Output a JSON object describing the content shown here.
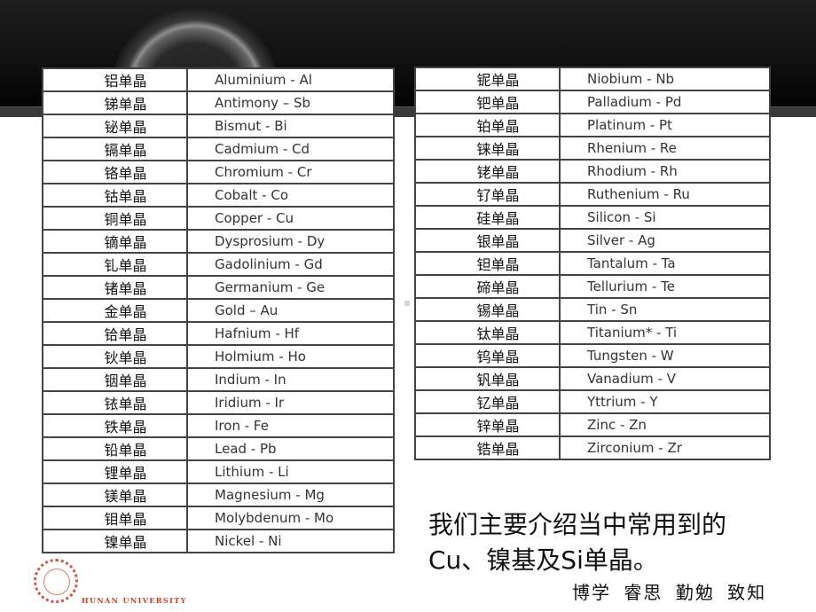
{
  "colors": {
    "header_bg": "#111111",
    "band": "#3a3a3a",
    "table_border": "#444444",
    "logo_red": "#c8402c"
  },
  "left_table": [
    {
      "cn": "铝单晶",
      "en": "Aluminium - Al"
    },
    {
      "cn": "锑单晶",
      "en": "Antimony – Sb"
    },
    {
      "cn": "铋单晶",
      "en": "Bismut - Bi"
    },
    {
      "cn": "镉单晶",
      "en": "Cadmium - Cd"
    },
    {
      "cn": "铬单晶",
      "en": "Chromium - Cr"
    },
    {
      "cn": "钴单晶",
      "en": "Cobalt - Co"
    },
    {
      "cn": "铜单晶",
      "en": "Copper - Cu"
    },
    {
      "cn": "镝单晶",
      "en": "Dysprosium - Dy"
    },
    {
      "cn": "钆单晶",
      "en": "Gadolinium - Gd"
    },
    {
      "cn": "锗单晶",
      "en": "Germanium - Ge"
    },
    {
      "cn": "金单晶",
      "en": "Gold – Au"
    },
    {
      "cn": "铪单晶",
      "en": "Hafnium - Hf"
    },
    {
      "cn": "钬单晶",
      "en": "Holmium - Ho"
    },
    {
      "cn": "铟单晶",
      "en": "Indium - In"
    },
    {
      "cn": "铱单晶",
      "en": "Iridium - Ir"
    },
    {
      "cn": "铁单晶",
      "en": "Iron - Fe"
    },
    {
      "cn": "铅单晶",
      "en": "Lead - Pb"
    },
    {
      "cn": "锂单晶",
      "en": "Lithium - Li"
    },
    {
      "cn": "镁单晶",
      "en": "Magnesium - Mg"
    },
    {
      "cn": "钼单晶",
      "en": "Molybdenum - Mo"
    },
    {
      "cn": "镍单晶",
      "en": "Nickel - Ni"
    }
  ],
  "right_table": [
    {
      "cn": "铌单晶",
      "en": "Niobium - Nb"
    },
    {
      "cn": "钯单晶",
      "en": "Palladium - Pd"
    },
    {
      "cn": "铂单晶",
      "en": "Platinum - Pt"
    },
    {
      "cn": "铼单晶",
      "en": "Rhenium - Re"
    },
    {
      "cn": "铑单晶",
      "en": "Rhodium - Rh"
    },
    {
      "cn": "钌单晶",
      "en": "Ruthenium - Ru"
    },
    {
      "cn": "硅单晶",
      "en": "Silicon - Si"
    },
    {
      "cn": "银单晶",
      "en": "Silver - Ag"
    },
    {
      "cn": "钽单晶",
      "en": "Tantalum - Ta"
    },
    {
      "cn": "碲单晶",
      "en": "Tellurium - Te"
    },
    {
      "cn": "锡单晶",
      "en": "Tin - Sn"
    },
    {
      "cn": "钛单晶",
      "en": "Titanium* - Ti"
    },
    {
      "cn": "钨单晶",
      "en": "Tungsten - W"
    },
    {
      "cn": "钒单晶",
      "en": "Vanadium - V"
    },
    {
      "cn": "钇单晶",
      "en": "Yttrium - Y"
    },
    {
      "cn": "锌单晶",
      "en": "Zinc - Zn"
    },
    {
      "cn": "锆单晶",
      "en": "Zirconium - Zr"
    }
  ],
  "note": {
    "line1": "我们主要介绍当中常用到的",
    "line2": "Cu、镍基及Si单晶。"
  },
  "motto": "博学 睿思 勤勉 致知",
  "logo": {
    "text": "HUNAN UNIVERSITY",
    "icon": "university-seal-icon"
  }
}
